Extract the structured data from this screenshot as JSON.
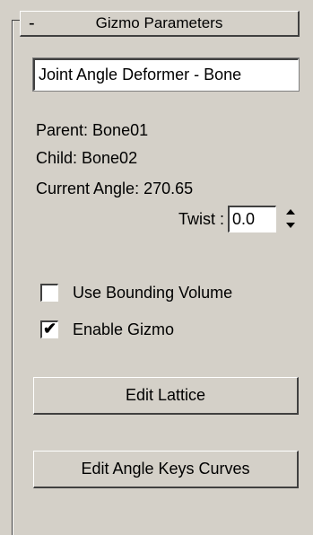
{
  "rollout": {
    "toggle": "-",
    "title": "Gizmo Parameters"
  },
  "name_field": {
    "value": "Joint Angle Deformer - Bone"
  },
  "info": {
    "parent": "Parent: Bone01",
    "child": "Child: Bone02",
    "current_angle": "Current Angle: 270.65"
  },
  "twist": {
    "label": "Twist :",
    "value": "0.0"
  },
  "checkboxes": {
    "use_bounding_volume": {
      "label": "Use Bounding Volume",
      "checked": false
    },
    "enable_gizmo": {
      "label": "Enable Gizmo",
      "checked": true,
      "mark": "✔"
    }
  },
  "buttons": {
    "edit_lattice": "Edit Lattice",
    "edit_angle_keys_curves": "Edit Angle Keys Curves"
  },
  "icons": {
    "spinner_up": "triangle-up",
    "spinner_down": "triangle-down"
  },
  "colors": {
    "panel_bg": "#d4d0c8",
    "field_bg": "#ffffff",
    "shadow": "#404040",
    "highlight": "#ffffff"
  }
}
